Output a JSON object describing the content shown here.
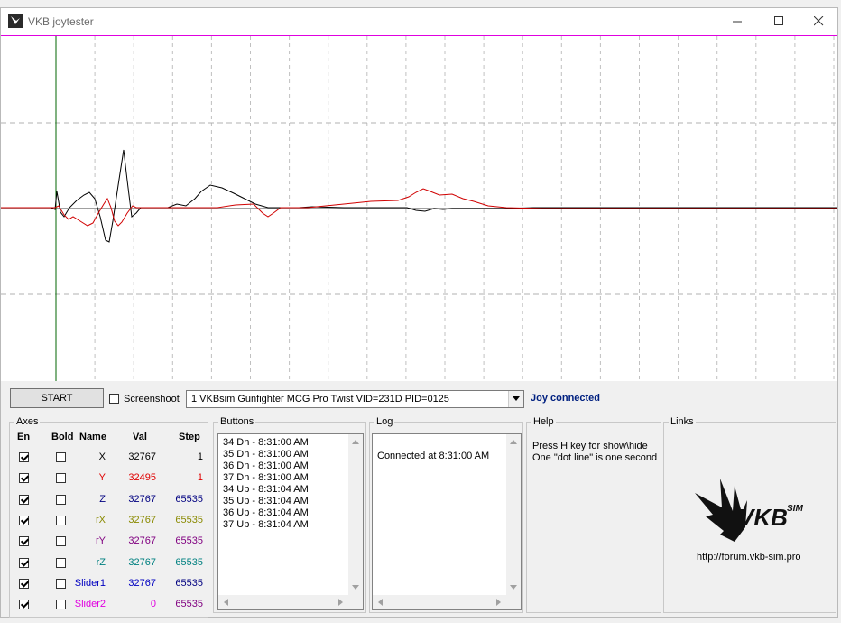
{
  "window": {
    "title": "VKB joytester",
    "minimize_icon": "minimize-icon",
    "maximize_icon": "maximize-icon",
    "close_icon": "close-icon"
  },
  "toolbar": {
    "start_label": "START",
    "screenshot_label": "Screenshoot",
    "device_selected": "1  VKBsim Gunfighter MCG Pro Twist  VID=231D PID=0125",
    "status": "Joy connected"
  },
  "axes": {
    "title": "Axes",
    "headers": {
      "en": "En",
      "bold": "Bold",
      "name": "Name",
      "val": "Val",
      "step": "Step"
    },
    "rows": [
      {
        "name": "X",
        "val": "32767",
        "step": "1",
        "color": "#000000",
        "step_color": "#000000"
      },
      {
        "name": "Y",
        "val": "32495",
        "step": "1",
        "color": "#e00000",
        "step_color": "#e00000"
      },
      {
        "name": "Z",
        "val": "32767",
        "step": "65535",
        "color": "#000080",
        "step_color": "#000080"
      },
      {
        "name": "rX",
        "val": "32767",
        "step": "65535",
        "color": "#8a8a00",
        "step_color": "#8a8a00"
      },
      {
        "name": "rY",
        "val": "32767",
        "step": "65535",
        "color": "#800080",
        "step_color": "#800080"
      },
      {
        "name": "rZ",
        "val": "32767",
        "step": "65535",
        "color": "#008080",
        "step_color": "#008080"
      },
      {
        "name": "Slider1",
        "val": "32767",
        "step": "65535",
        "color": "#0000c0",
        "step_color": "#000080"
      },
      {
        "name": "Slider2",
        "val": "0",
        "step": "65535",
        "color": "#e000e0",
        "step_color": "#800080"
      }
    ]
  },
  "buttons": {
    "title": "Buttons",
    "lines": [
      "34 Dn - 8:31:00 AM",
      "35 Dn - 8:31:00 AM",
      "36 Dn - 8:31:00 AM",
      "37 Dn - 8:31:00 AM",
      "34 Up - 8:31:04 AM",
      "35 Up - 8:31:04 AM",
      "36 Up - 8:31:04 AM",
      "37 Up - 8:31:04 AM"
    ]
  },
  "log": {
    "title": "Log",
    "lines": [
      "Connected at 8:31:00 AM"
    ]
  },
  "help": {
    "title": "Help",
    "lines": [
      "Press H key for show\\hide",
      "One \"dot line\" is one second"
    ]
  },
  "links": {
    "title": "Links",
    "logo_text": "VKB",
    "logo_sup": "SIM",
    "url": "http://forum.vkb-sim.pro"
  },
  "colors": {
    "trace_x": "#000000",
    "trace_y": "#d00000",
    "cursor": "#006400",
    "top_line": "#e000e0"
  }
}
